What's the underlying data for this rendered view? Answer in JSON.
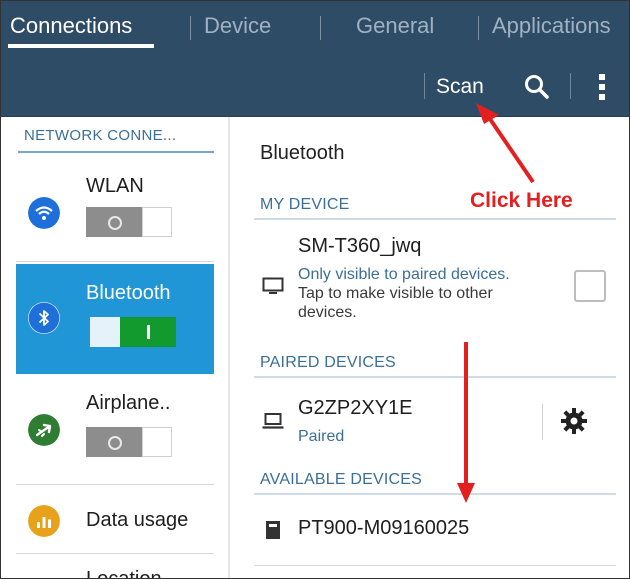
{
  "tabs": [
    {
      "label": "Connections",
      "active": true
    },
    {
      "label": "Device",
      "active": false
    },
    {
      "label": "General",
      "active": false
    },
    {
      "label": "Applications",
      "active": false
    }
  ],
  "actionbar": {
    "scan_label": "Scan",
    "search_icon": "search-icon",
    "more_icon": "more-vertical-icon"
  },
  "sidebar": {
    "header": "NETWORK CONNE...",
    "items": [
      {
        "label": "WLAN",
        "icon": "wifi-icon",
        "icon_color": "#1e6fd9",
        "toggle": "off"
      },
      {
        "label": "Bluetooth",
        "icon": "bluetooth-icon",
        "icon_color": "#1e6fd9",
        "toggle": "on",
        "selected": true
      },
      {
        "label": "Airplane..",
        "icon": "airplane-icon",
        "icon_color": "#2f7d32",
        "toggle": "off"
      },
      {
        "label": "Data usage",
        "icon": "data-usage-icon",
        "icon_color": "#e7a11b"
      },
      {
        "label": "Location",
        "icon": "location-icon"
      }
    ]
  },
  "panel": {
    "title": "Bluetooth",
    "my_device_header": "MY DEVICE",
    "my_device": {
      "name": "SM-T360_jwq",
      "status_line1": "Only visible to paired devices.",
      "status_line2": "Tap to make visible to other",
      "status_line3": "devices.",
      "icon": "tablet-icon"
    },
    "paired_header": "PAIRED DEVICES",
    "paired": [
      {
        "name": "G2ZP2XY1E",
        "status": "Paired",
        "icon": "laptop-icon"
      }
    ],
    "available_header": "AVAILABLE DEVICES",
    "available": [
      {
        "name": "PT900-M09160025",
        "icon": "printer-icon"
      }
    ]
  },
  "annotation": {
    "text": "Click Here",
    "color": "#e41f1f"
  },
  "colors": {
    "toolbar": "#2f4c66",
    "accent": "#2196d6",
    "section_text": "#3b6f96",
    "toggle_on": "#139a2e"
  }
}
